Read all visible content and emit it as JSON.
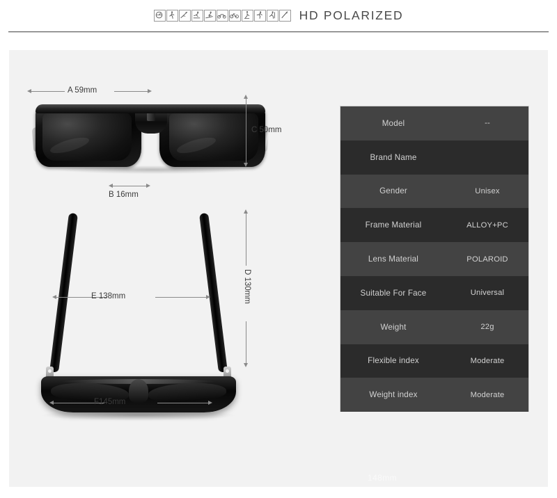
{
  "header": {
    "title": "HD POLARIZED",
    "icons": [
      {
        "name": "driving-icon"
      },
      {
        "name": "walking-icon"
      },
      {
        "name": "fishing-icon"
      },
      {
        "name": "skating-icon"
      },
      {
        "name": "skiing-icon"
      },
      {
        "name": "motorcycling-icon"
      },
      {
        "name": "cycling-icon"
      },
      {
        "name": "golf-icon"
      },
      {
        "name": "running-icon"
      },
      {
        "name": "hiking-icon"
      },
      {
        "name": "climbing-icon"
      }
    ]
  },
  "figures": {
    "front_view": {
      "name": "sunglasses-front-view",
      "dimensions": {
        "width_label": "A 59mm",
        "bridge_label": "B 16mm",
        "height_label": "C 50mm"
      }
    },
    "top_view": {
      "name": "sunglasses-top-view",
      "dimensions": {
        "temple_label": "D 130mm",
        "inner_width_label": "E 138mm",
        "outer_width_label": "F145mm"
      }
    }
  },
  "spec_table": {
    "rows": [
      {
        "key": "Model",
        "value": "--"
      },
      {
        "key": "Brand Name",
        "value": ""
      },
      {
        "key": "Gender",
        "value": "Unisex"
      },
      {
        "key": "Frame Material",
        "value": "ALLOY+PC"
      },
      {
        "key": "Lens Material",
        "value": "POLAROID"
      },
      {
        "key": "Suitable For Face",
        "value": "Universal"
      },
      {
        "key": "Weight",
        "value": "22g"
      },
      {
        "key": "Flexible index",
        "value": "Moderate"
      },
      {
        "key": "Weight index",
        "value": "Moderate"
      }
    ],
    "footnote": "148mm"
  },
  "colors": {
    "page_background": "#ffffff",
    "panel_background": "#f2f2f2",
    "title_text": "#4a4a4a",
    "table_row_light": "#434343",
    "table_row_dark": "#2b2b2b",
    "table_text": "#d2d2d2",
    "dimension_line": "#8a8a8a"
  }
}
